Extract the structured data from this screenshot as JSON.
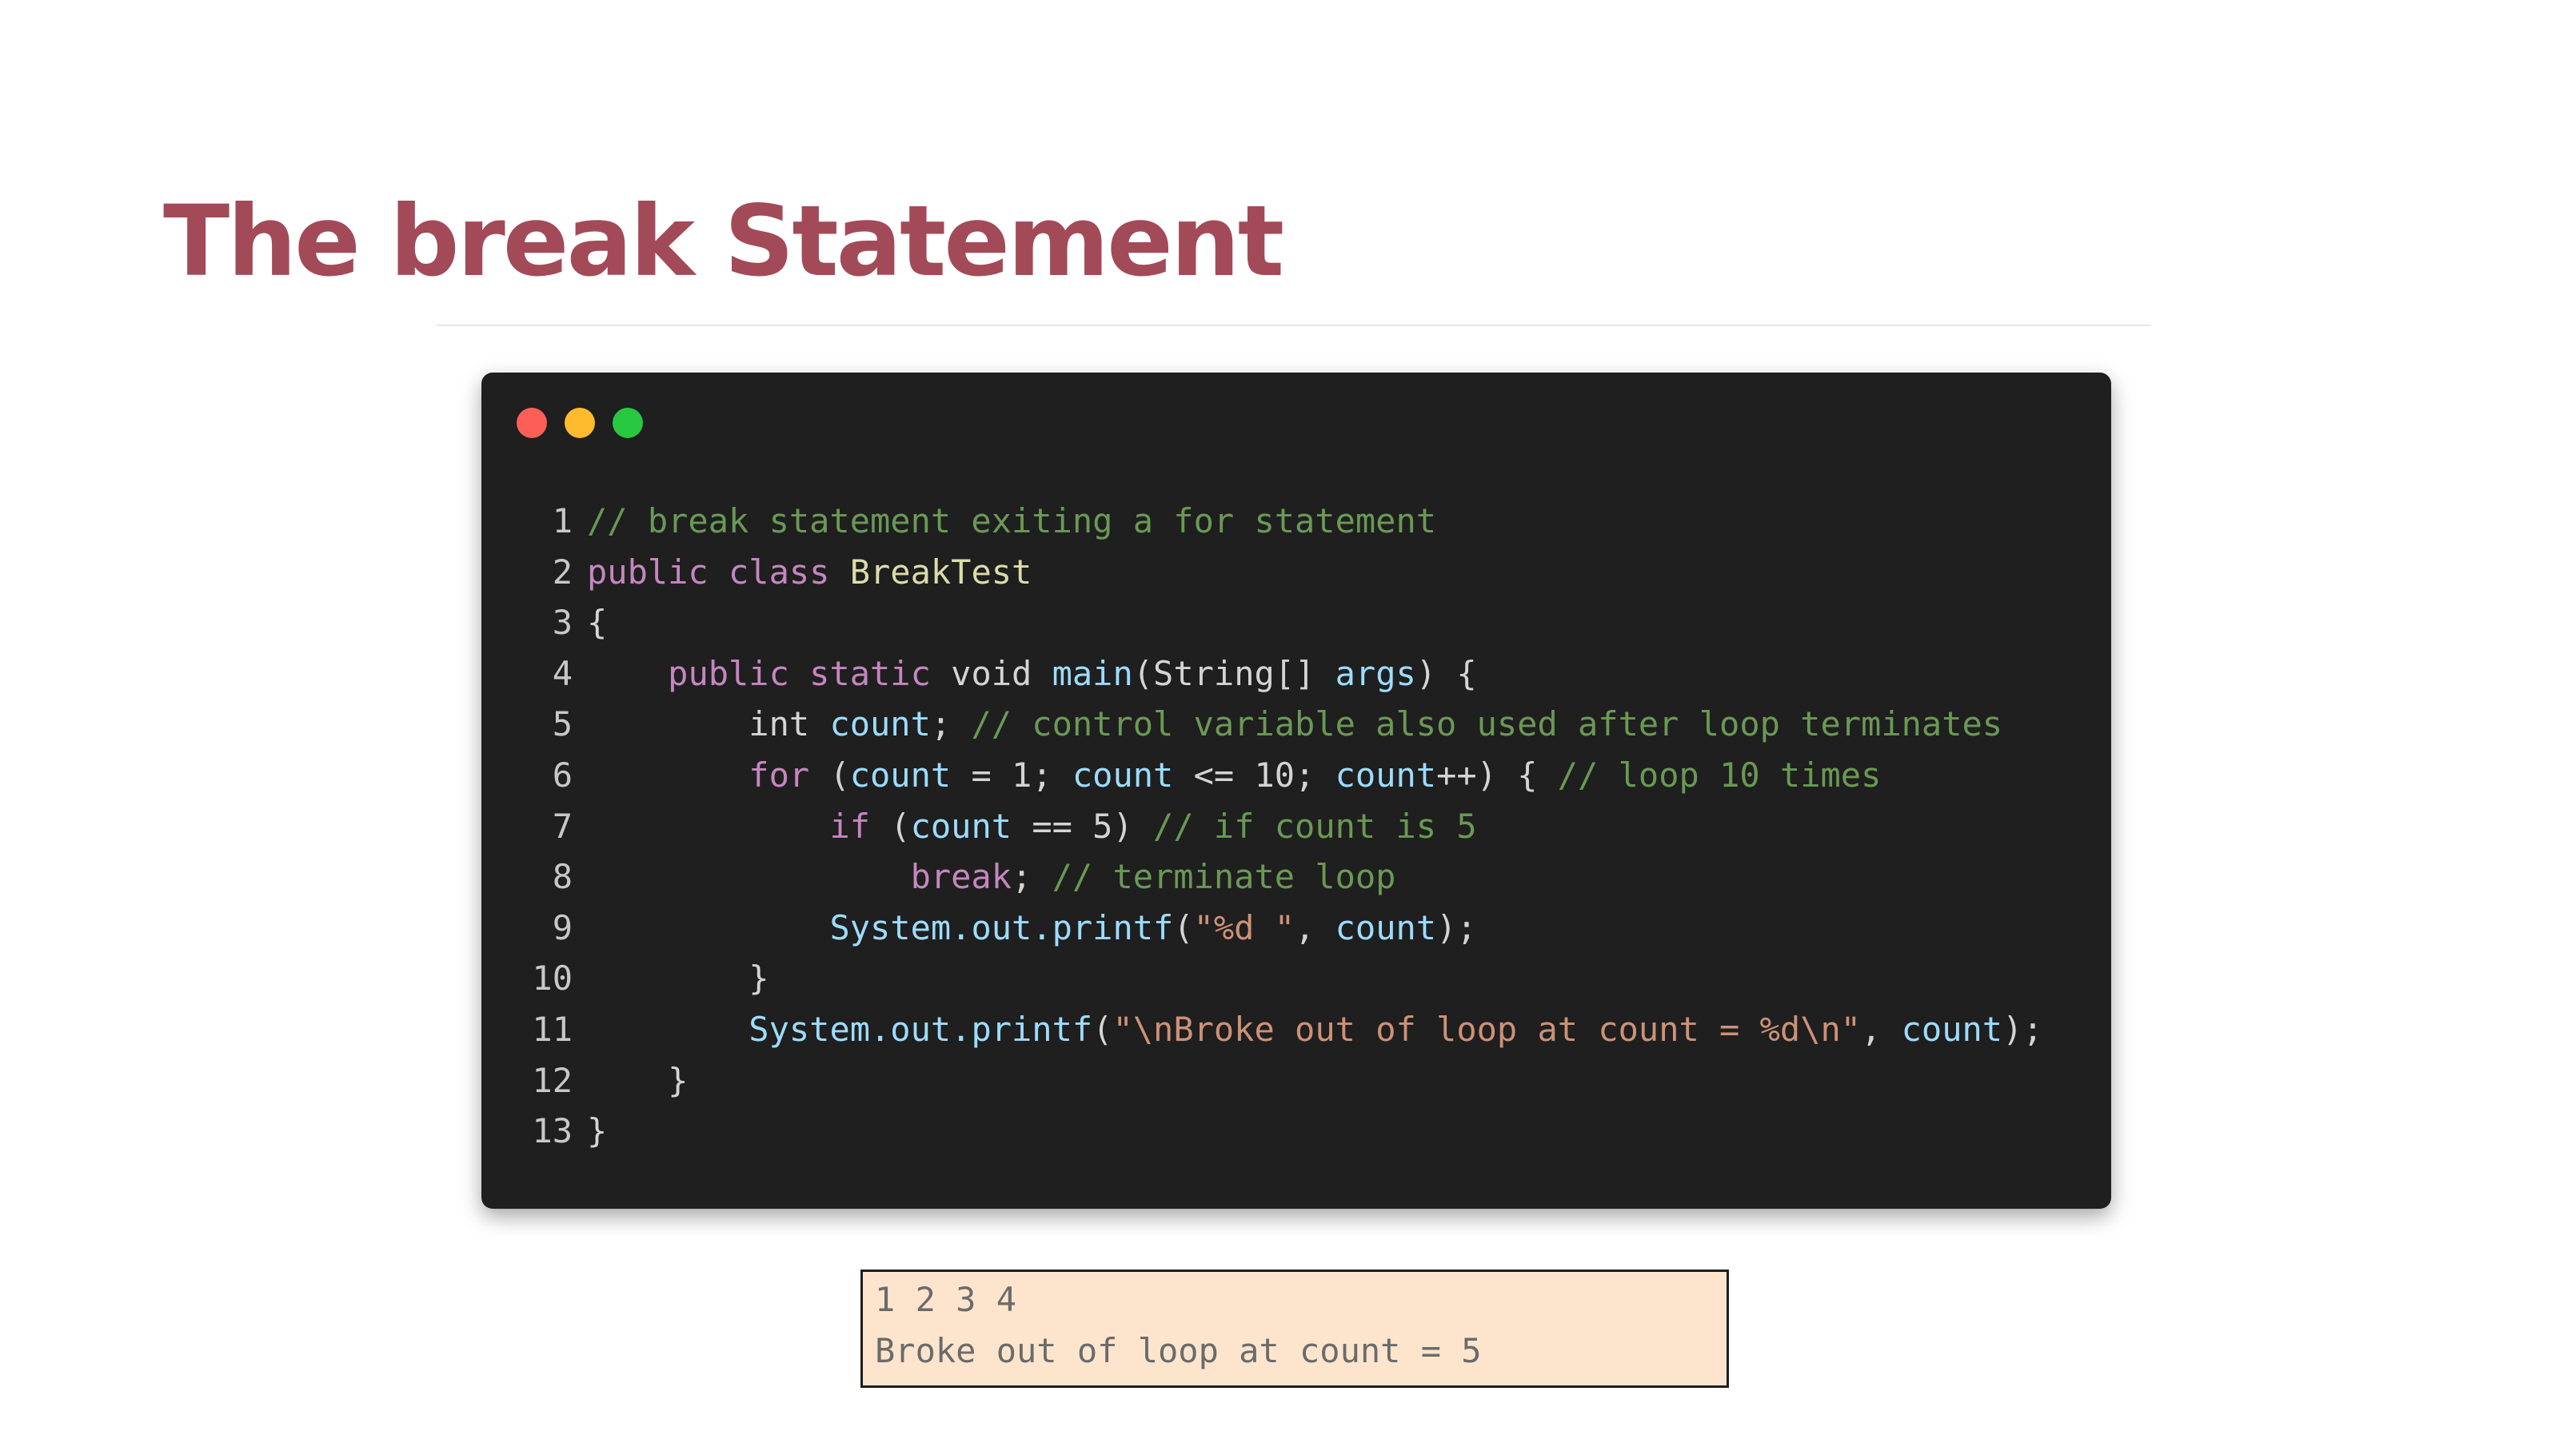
{
  "slide": {
    "title": "The break Statement"
  },
  "code_window": {
    "lines": [
      {
        "num": "1",
        "tokens": [
          {
            "t": "// break statement exiting a for statement",
            "k": "comment"
          }
        ]
      },
      {
        "num": "2",
        "tokens": [
          {
            "t": "public class ",
            "k": "keyword"
          },
          {
            "t": "BreakTest",
            "k": "class"
          }
        ]
      },
      {
        "num": "3",
        "tokens": [
          {
            "t": "{",
            "k": "plain"
          }
        ]
      },
      {
        "num": "4",
        "tokens": [
          {
            "t": "    ",
            "k": "plain"
          },
          {
            "t": "public static ",
            "k": "keyword"
          },
          {
            "t": "void ",
            "k": "plain"
          },
          {
            "t": "main",
            "k": "func"
          },
          {
            "t": "(String[] ",
            "k": "plain"
          },
          {
            "t": "args",
            "k": "var"
          },
          {
            "t": ") {",
            "k": "plain"
          }
        ]
      },
      {
        "num": "5",
        "tokens": [
          {
            "t": "        int ",
            "k": "plain"
          },
          {
            "t": "count",
            "k": "var"
          },
          {
            "t": "; ",
            "k": "plain"
          },
          {
            "t": "// control variable also used after loop terminates",
            "k": "comment"
          }
        ]
      },
      {
        "num": "6",
        "tokens": [
          {
            "t": "        ",
            "k": "plain"
          },
          {
            "t": "for",
            "k": "keyword"
          },
          {
            "t": " (",
            "k": "plain"
          },
          {
            "t": "count",
            "k": "var"
          },
          {
            "t": " = 1; ",
            "k": "plain"
          },
          {
            "t": "count",
            "k": "var"
          },
          {
            "t": " <= 10; ",
            "k": "plain"
          },
          {
            "t": "count",
            "k": "var"
          },
          {
            "t": "++) { ",
            "k": "plain"
          },
          {
            "t": "// loop 10 times",
            "k": "comment"
          }
        ]
      },
      {
        "num": "7",
        "tokens": [
          {
            "t": "            ",
            "k": "plain"
          },
          {
            "t": "if",
            "k": "keyword"
          },
          {
            "t": " (",
            "k": "plain"
          },
          {
            "t": "count",
            "k": "var"
          },
          {
            "t": " == 5) ",
            "k": "plain"
          },
          {
            "t": "// if count is 5",
            "k": "comment"
          }
        ]
      },
      {
        "num": "8",
        "tokens": [
          {
            "t": "                ",
            "k": "plain"
          },
          {
            "t": "break",
            "k": "keyword"
          },
          {
            "t": "; ",
            "k": "plain"
          },
          {
            "t": "// terminate loop",
            "k": "comment"
          }
        ]
      },
      {
        "num": "9",
        "tokens": [
          {
            "t": "            ",
            "k": "plain"
          },
          {
            "t": "System.out.printf",
            "k": "func"
          },
          {
            "t": "(",
            "k": "plain"
          },
          {
            "t": "\"%d \"",
            "k": "string"
          },
          {
            "t": ", ",
            "k": "plain"
          },
          {
            "t": "count",
            "k": "var"
          },
          {
            "t": ");",
            "k": "plain"
          }
        ]
      },
      {
        "num": "10",
        "tokens": [
          {
            "t": "        }",
            "k": "plain"
          }
        ]
      },
      {
        "num": "11",
        "tokens": [
          {
            "t": "        ",
            "k": "plain"
          },
          {
            "t": "System.out.printf",
            "k": "func"
          },
          {
            "t": "(",
            "k": "plain"
          },
          {
            "t": "\"\\nBroke out of loop at count = %d\\n\"",
            "k": "string"
          },
          {
            "t": ", ",
            "k": "plain"
          },
          {
            "t": "count",
            "k": "var"
          },
          {
            "t": ");",
            "k": "plain"
          }
        ]
      },
      {
        "num": "12",
        "tokens": [
          {
            "t": "    }",
            "k": "plain"
          }
        ]
      },
      {
        "num": "13",
        "tokens": [
          {
            "t": "}",
            "k": "plain"
          }
        ]
      }
    ]
  },
  "output": {
    "lines": [
      "1 2 3 4",
      "Broke out of loop at count = 5"
    ]
  }
}
